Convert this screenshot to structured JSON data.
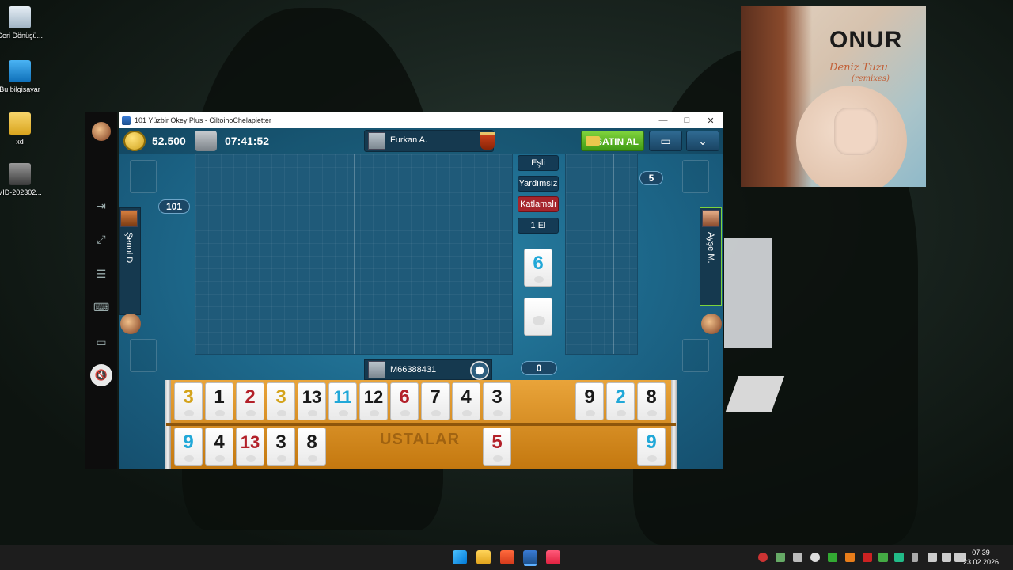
{
  "desktop": {
    "icons": [
      {
        "label": "Geri Dönüşü..."
      },
      {
        "label": "Bu bilgisayar"
      },
      {
        "label": "xd"
      },
      {
        "label": "VID-202302..."
      }
    ]
  },
  "album_art": {
    "artist": "ONUR",
    "song": "Deniz Tuzu",
    "subtitle": "(remixes)"
  },
  "window": {
    "title": "101 Yüzbir Okey Plus - CiltoihoChelapietter",
    "minimize": "—",
    "maximize": "□",
    "close": "✕"
  },
  "game": {
    "chips": "52.500",
    "timer": "07:41:52",
    "top_player": "Furkan A.",
    "buy_label": "SATIN AL",
    "left_player": "Şenol D.",
    "right_player": "Ayşe M.",
    "bottom_player": "M66388431",
    "score_badge_left": "101",
    "score_badge_right": "5",
    "score_badge_bottom": "0",
    "mode_labels": [
      "Eşli",
      "Yardımsız",
      "Katlamalı",
      "1 El"
    ],
    "indicator_tile": {
      "value": "6",
      "color": "#21a8d8"
    },
    "rack_stamp": "USTALAR",
    "rack_top": [
      {
        "value": "3",
        "color": "yellow"
      },
      {
        "value": "1",
        "color": "black"
      },
      {
        "value": "2",
        "color": "red"
      },
      {
        "value": "3",
        "color": "yellow"
      },
      {
        "value": "13",
        "color": "black"
      },
      {
        "value": "11",
        "color": "blue"
      },
      {
        "value": "12",
        "color": "black"
      },
      {
        "value": "6",
        "color": "red"
      },
      {
        "value": "7",
        "color": "black"
      },
      {
        "value": "4",
        "color": "black"
      },
      {
        "value": "3",
        "color": "black"
      },
      {
        "value": "9",
        "color": "black"
      },
      {
        "value": "2",
        "color": "blue"
      },
      {
        "value": "8",
        "color": "black"
      }
    ],
    "rack_bottom": [
      {
        "value": "9",
        "color": "blue"
      },
      {
        "value": "4",
        "color": "black"
      },
      {
        "value": "13",
        "color": "red"
      },
      {
        "value": "3",
        "color": "black"
      },
      {
        "value": "8",
        "color": "black"
      },
      {
        "value": "5",
        "color": "red"
      },
      {
        "value": "9",
        "color": "blue"
      }
    ]
  },
  "taskbar": {
    "time": "07:39",
    "date": "23.02.2026"
  }
}
